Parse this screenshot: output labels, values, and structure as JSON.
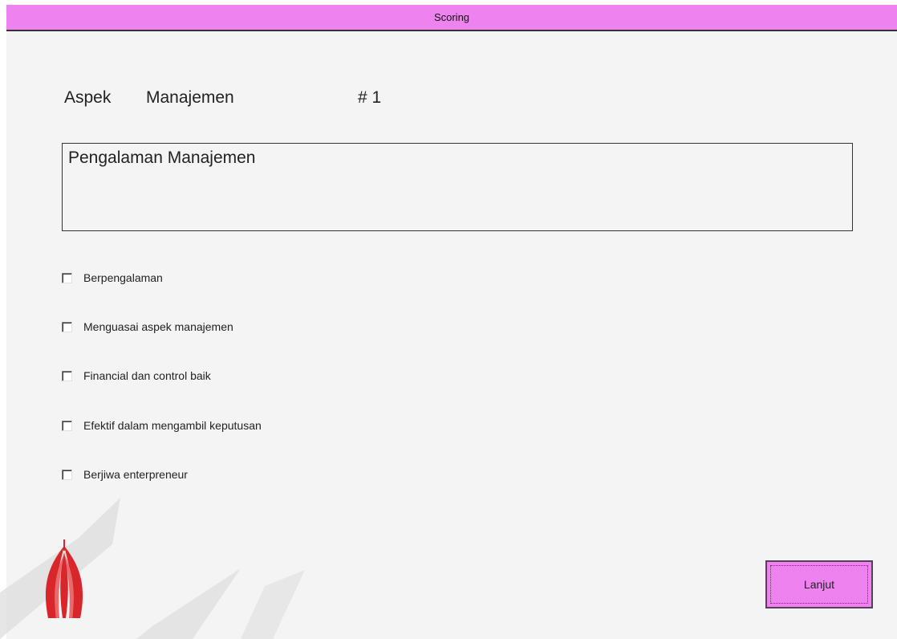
{
  "window": {
    "title": "Scoring"
  },
  "header": {
    "aspek_label": "Aspek",
    "category": "Manajemen",
    "number": "# 1"
  },
  "question": {
    "text": "Pengalaman Manajemen"
  },
  "options": [
    {
      "label": "Berpengalaman",
      "checked": false
    },
    {
      "label": "Menguasai aspek manajemen",
      "checked": false
    },
    {
      "label": "Financial dan control baik",
      "checked": false
    },
    {
      "label": "Efektif dalam mengambil keputusan",
      "checked": false
    },
    {
      "label": "Berjiwa enterpreneur",
      "checked": false
    }
  ],
  "actions": {
    "next_label": "Lanjut"
  },
  "colors": {
    "accent": "#ee82ee",
    "background": "#f4f4f4",
    "watermark_red": "#d8262b"
  }
}
